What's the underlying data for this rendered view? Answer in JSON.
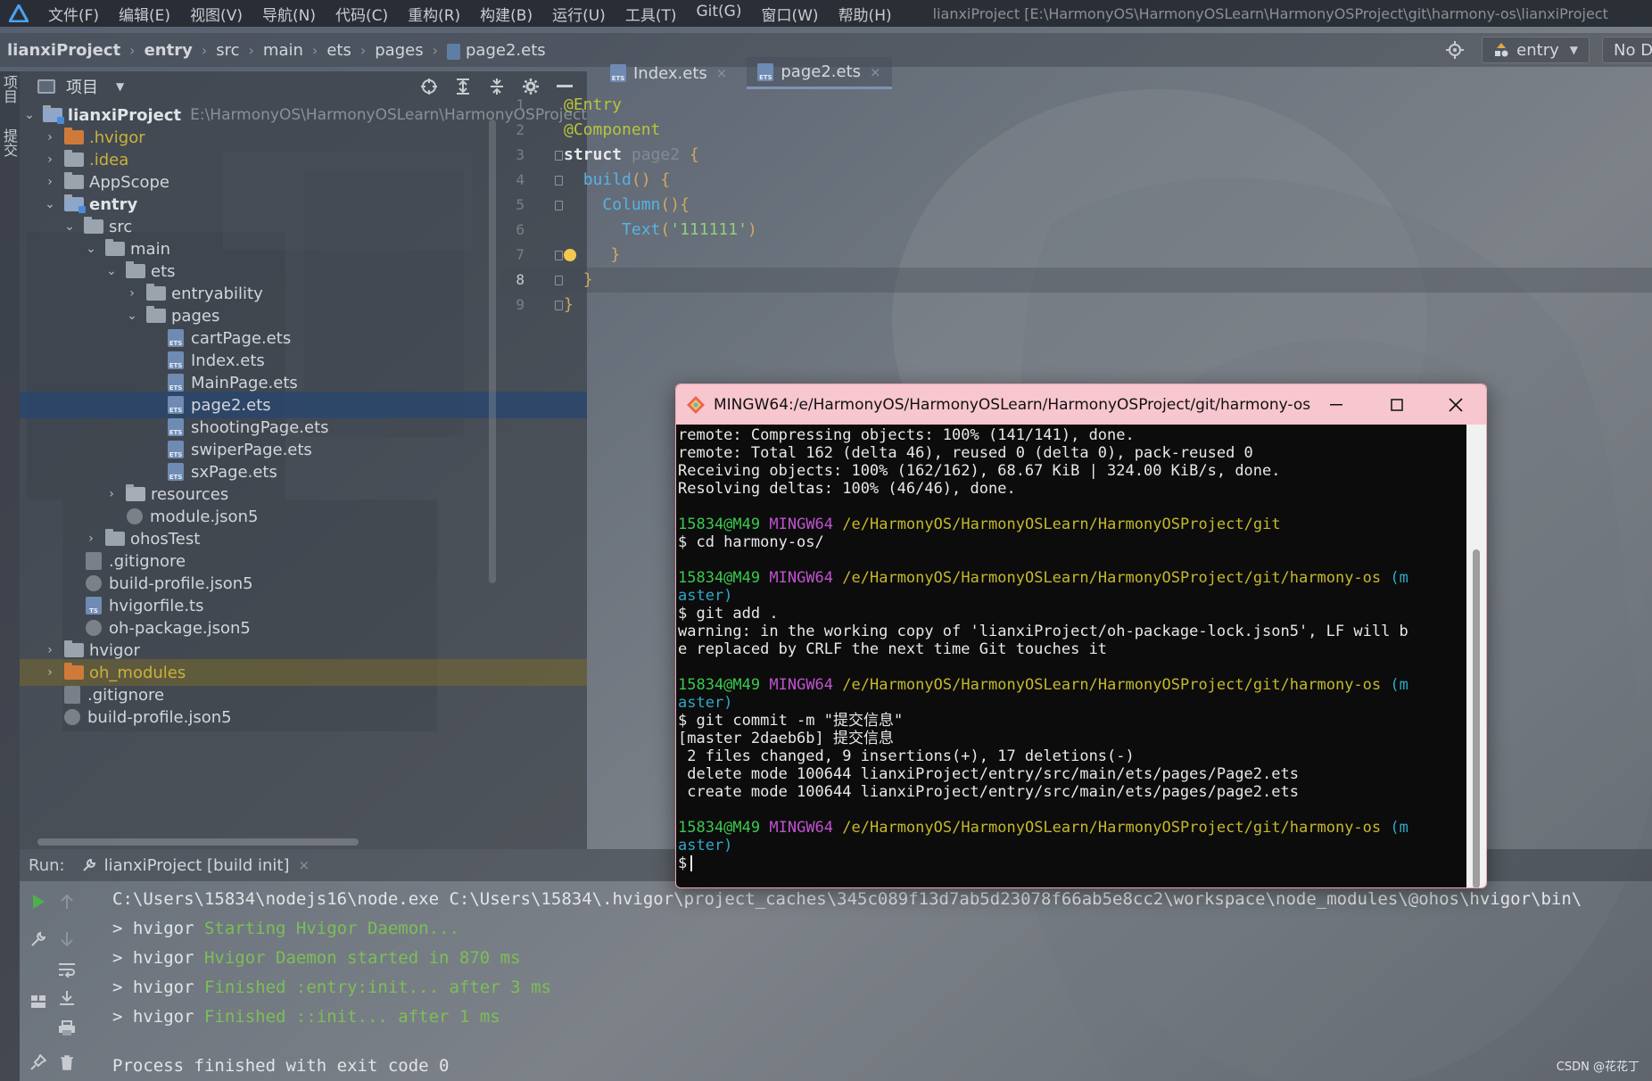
{
  "menu": {
    "items": [
      "文件(F)",
      "编辑(E)",
      "视图(V)",
      "导航(N)",
      "代码(C)",
      "重构(R)",
      "构建(B)",
      "运行(U)",
      "工具(T)",
      "Git(G)",
      "窗口(W)",
      "帮助(H)"
    ],
    "window_title": "lianxiProject [E:\\HarmonyOS\\HarmonyOSLearn\\HarmonyOSProject\\git\\harmony-os\\lianxiProject"
  },
  "breadcrumb": {
    "items": [
      "lianxiProject",
      "entry",
      "src",
      "main",
      "ets",
      "pages",
      "page2.ets"
    ]
  },
  "toolbar": {
    "run_config": "entry",
    "device": "No D"
  },
  "left_strip": {
    "tab1": "项目",
    "tab2": "提交"
  },
  "project_panel": {
    "title": "项目",
    "tree": [
      {
        "label": "lianxiProject",
        "path": "E:\\HarmonyOS\\HarmonyOSLearn\\HarmonyOSProject"
      },
      {
        "label": ".hvigor"
      },
      {
        "label": ".idea"
      },
      {
        "label": "AppScope"
      },
      {
        "label": "entry"
      },
      {
        "label": "src"
      },
      {
        "label": "main"
      },
      {
        "label": "ets"
      },
      {
        "label": "entryability"
      },
      {
        "label": "pages"
      },
      {
        "label": "cartPage.ets"
      },
      {
        "label": "Index.ets"
      },
      {
        "label": "MainPage.ets"
      },
      {
        "label": "page2.ets"
      },
      {
        "label": "shootingPage.ets"
      },
      {
        "label": "swiperPage.ets"
      },
      {
        "label": "sxPage.ets"
      },
      {
        "label": "resources"
      },
      {
        "label": "module.json5"
      },
      {
        "label": "ohosTest"
      },
      {
        "label": ".gitignore"
      },
      {
        "label": "build-profile.json5"
      },
      {
        "label": "hvigorfile.ts"
      },
      {
        "label": "oh-package.json5"
      },
      {
        "label": "hvigor"
      },
      {
        "label": "oh_modules"
      },
      {
        "label": ".gitignore"
      },
      {
        "label": "build-profile.json5"
      }
    ],
    "file_badge": "ETS",
    "file_badge_ts": "TS"
  },
  "editor": {
    "tabs": [
      {
        "label": "Index.ets",
        "close": "×"
      },
      {
        "label": "page2.ets",
        "close": "×"
      }
    ],
    "line_numbers": [
      "1",
      "2",
      "3",
      "4",
      "5",
      "6",
      "7",
      "8",
      "9"
    ],
    "code": {
      "l1": "@Entry",
      "l2": "@Component",
      "l3_kw": "struct",
      "l3_name": "page2",
      "l3_brace": "{",
      "l4_fn": "build",
      "l4_paren": "()",
      "l4_brace": "{",
      "l5_fn": "Column",
      "l5_paren": "(){",
      "l6_fn": "Text",
      "l6_open": "(",
      "l6_str": "'111111'",
      "l6_close": ")",
      "l7": "}",
      "l8": "}",
      "l9": "}"
    }
  },
  "terminal": {
    "title": "MINGW64:/e/HarmonyOS/HarmonyOSLearn/HarmonyOSProject/git/harmony-os",
    "lines": {
      "l1": "remote: Compressing objects: 100% (141/141), done.",
      "l2": "remote: Total 162 (delta 46), reused 0 (delta 0), pack-reused 0",
      "l3": "Receiving objects: 100% (162/162), 68.67 KiB | 324.00 KiB/s, done.",
      "l4": "Resolving deltas: 100% (46/46), done.",
      "prompt_user": "15834@M49",
      "prompt_host": "MINGW64",
      "prompt_path1": "/e/HarmonyOS/HarmonyOSLearn/HarmonyOSProject/git",
      "cmd1": "$ cd harmony-os/",
      "prompt_path2": "/e/HarmonyOS/HarmonyOSLearn/HarmonyOSProject/git/harmony-os",
      "branch_a": "(m",
      "branch_b": "aster)",
      "cmd2": "$ git add .",
      "warn1": "warning: in the working copy of 'lianxiProject/oh-package-lock.json5', LF will b",
      "warn2": "e replaced by CRLF the next time Git touches it",
      "cmd3": "$ git commit -m \"提交信息\"",
      "out1": "[master 2daeb6b] 提交信息",
      "out2": " 2 files changed, 9 insertions(+), 17 deletions(-)",
      "out3": " delete mode 100644 lianxiProject/entry/src/main/ets/pages/Page2.ets",
      "out4": " create mode 100644 lianxiProject/entry/src/main/ets/pages/page2.ets",
      "cmd4": "$"
    }
  },
  "run_panel": {
    "label": "Run:",
    "tab": "lianxiProject [build init]",
    "tab_close": "×",
    "lines": {
      "l1": "C:\\Users\\15834\\nodejs16\\node.exe C:\\Users\\15834\\.hvigor\\project_caches\\345c089f13d7ab5d23078f66ab5e8cc2\\workspace\\node_modules\\@ohos\\hvigor\\bin\\",
      "l2_prefix": "> hvigor ",
      "l2_msg": "Starting Hvigor Daemon...",
      "l3_prefix": "> hvigor ",
      "l3_msg": "Hvigor Daemon started in 870 ms",
      "l4_prefix": "> hvigor ",
      "l4_msg": "Finished :entry:init... after 3 ms",
      "l5_prefix": "> hvigor ",
      "l5_msg": "Finished ::init... after 1 ms",
      "l6": "Process finished with exit code 0"
    }
  },
  "watermark": "CSDN @花花丁"
}
